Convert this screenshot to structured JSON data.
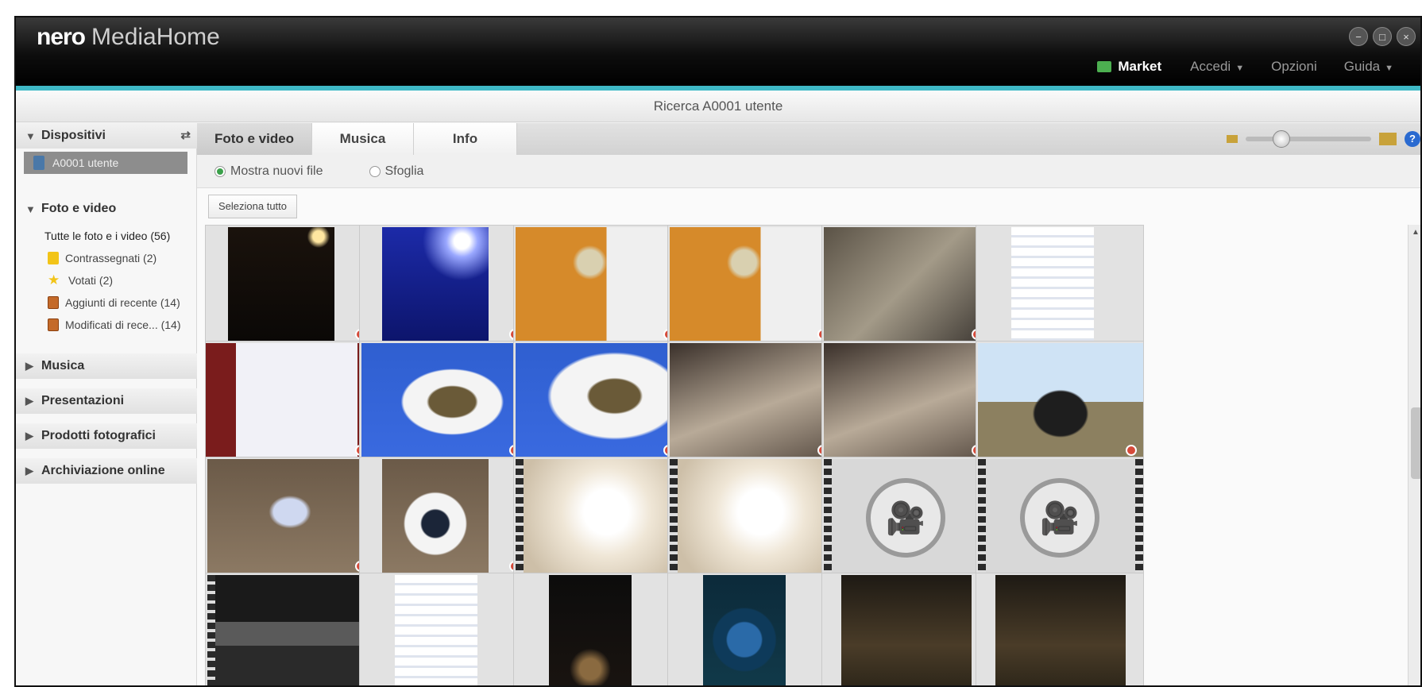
{
  "window": {
    "brand": "nero",
    "app": "MediaHome",
    "controls": [
      "−",
      "□",
      "×"
    ]
  },
  "menubar": {
    "market": "Market",
    "items": [
      {
        "label": "Accedi",
        "has_caret": true
      },
      {
        "label": "Opzioni",
        "has_caret": false
      },
      {
        "label": "Guida",
        "has_caret": true
      }
    ]
  },
  "subtitle": "Ricerca A0001 utente",
  "sidebar": {
    "devices": {
      "label": "Dispositivi",
      "device": "A0001 utente"
    },
    "photos": {
      "label": "Foto e video",
      "items": [
        {
          "label": "Tutte le foto e i video (56)",
          "icon": "none"
        },
        {
          "label": "Contrassegnati (2)",
          "icon": "tag-icon"
        },
        {
          "label": "Votati (2)",
          "icon": "star-icon"
        },
        {
          "label": "Aggiunti di recente (14)",
          "icon": "added-icon"
        },
        {
          "label": "Modificati di rece... (14)",
          "icon": "modified-icon"
        }
      ]
    },
    "sections": [
      "Musica",
      "Presentazioni",
      "Prodotti fotografici",
      "Archiviazione online"
    ]
  },
  "tabs": [
    "Foto e video",
    "Musica",
    "Info"
  ],
  "filter": {
    "option1": "Mostra nuovi file",
    "option2": "Sfoglia",
    "selected": "option1"
  },
  "select_all": "Seleziona tutto",
  "zoom_level": 0.25,
  "thumbnails": [
    {
      "row": 0,
      "col": 0,
      "kind": "photo",
      "subject": "night concert",
      "badge": true
    },
    {
      "row": 0,
      "col": 1,
      "kind": "photo",
      "subject": "blue stage dancers",
      "badge": true
    },
    {
      "row": 0,
      "col": 2,
      "kind": "photo",
      "subject": "film projector",
      "badge": true
    },
    {
      "row": 0,
      "col": 3,
      "kind": "photo",
      "subject": "film projector",
      "badge": true
    },
    {
      "row": 0,
      "col": 4,
      "kind": "photo",
      "subject": "projector machinery",
      "badge": true
    },
    {
      "row": 0,
      "col": 5,
      "kind": "photo",
      "subject": "phone screenshot",
      "badge": false
    },
    {
      "row": 1,
      "col": 0,
      "kind": "photo",
      "subject": "printed page",
      "badge": true
    },
    {
      "row": 1,
      "col": 1,
      "kind": "photo",
      "subject": "fish on plate",
      "badge": true
    },
    {
      "row": 1,
      "col": 2,
      "kind": "photo",
      "subject": "fish with fork",
      "badge": true
    },
    {
      "row": 1,
      "col": 3,
      "kind": "photo",
      "subject": "dark floor",
      "badge": true
    },
    {
      "row": 1,
      "col": 4,
      "kind": "photo",
      "subject": "dark floor",
      "badge": true
    },
    {
      "row": 1,
      "col": 5,
      "kind": "photo",
      "subject": "man portrait",
      "badge": true
    },
    {
      "row": 2,
      "col": 0,
      "kind": "photo",
      "subject": "fish on sand",
      "badge": true
    },
    {
      "row": 2,
      "col": 1,
      "kind": "photo",
      "subject": "fish bowl",
      "badge": true
    },
    {
      "row": 2,
      "col": 2,
      "kind": "video",
      "subject": "blurred light",
      "badge": false
    },
    {
      "row": 2,
      "col": 3,
      "kind": "video",
      "subject": "blurred light",
      "badge": false
    },
    {
      "row": 2,
      "col": 4,
      "kind": "video",
      "subject": "video placeholder",
      "badge": false
    },
    {
      "row": 2,
      "col": 5,
      "kind": "video",
      "subject": "video placeholder",
      "badge": false
    },
    {
      "row": 3,
      "col": 0,
      "kind": "video",
      "subject": "dark room",
      "badge": false
    },
    {
      "row": 3,
      "col": 1,
      "kind": "photo",
      "subject": "phone screenshot",
      "badge": false
    },
    {
      "row": 3,
      "col": 2,
      "kind": "photo",
      "subject": "dark scene",
      "badge": false
    },
    {
      "row": 3,
      "col": 3,
      "kind": "photo",
      "subject": "app screen",
      "badge": false
    },
    {
      "row": 3,
      "col": 4,
      "kind": "photo",
      "subject": "night street",
      "badge": false
    },
    {
      "row": 3,
      "col": 5,
      "kind": "photo",
      "subject": "night street",
      "badge": false
    }
  ]
}
